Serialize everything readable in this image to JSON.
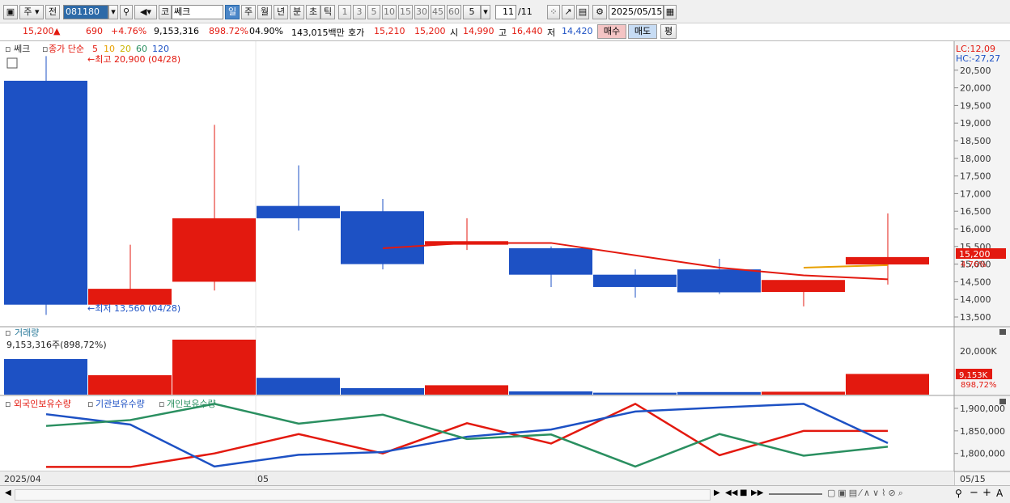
{
  "toolbar": {
    "period_short": "주",
    "prev_label": "전",
    "code": "081180",
    "search_label": "코",
    "stock_name": "쎄크",
    "periods": [
      "일",
      "주",
      "월",
      "년",
      "분",
      "초",
      "틱"
    ],
    "intervals": [
      "1",
      "3",
      "5",
      "10",
      "15",
      "30",
      "45",
      "60"
    ],
    "interval_value": "5",
    "page": "11",
    "page_total": "/11",
    "date": "2025/05/15"
  },
  "quote": {
    "price": "15,200",
    "arrow": "▲",
    "change": "690",
    "change_pct": "+4.76%",
    "volume": "9,153,316",
    "volume_pct": "898.72%",
    "turnover": "04.90%",
    "amount": "143,015백만",
    "hoga_label": "호가",
    "ask": "15,210",
    "bid": "15,200",
    "open_label": "시",
    "open": "14,990",
    "high_label": "고",
    "high": "16,440",
    "low_label": "저",
    "low": "14,420",
    "buy_label": "매수",
    "sell_label": "매도",
    "eval_label": "평"
  },
  "chart": {
    "title": "쎄크",
    "ma_title": "종가 단순",
    "ma_periods": [
      "5",
      "10",
      "20",
      "60",
      "120"
    ],
    "ma_colors": [
      "#e3190f",
      "#e8a000",
      "#c8b400",
      "#2a8f60",
      "#1d51c4"
    ],
    "max_label": "←최고 20,900 (04/28)",
    "min_label": "←최저 13,560 (04/28)",
    "lc": "LC:12,09",
    "hc": "HC:-27,27",
    "price_label": "15,200",
    "pct_label": "4.76%",
    "x_labels": [
      "2025/04",
      "05",
      "05/15"
    ],
    "volume_title": "거래량",
    "volume_value": "9,153,316주(898,72%)",
    "volume_axis": "20,000K",
    "volume_now": "9,153K",
    "volume_pct": "898,72%",
    "holdings_titles": [
      "외국인보유수량",
      "기관보유수량",
      "개인보유수량"
    ]
  },
  "chart_data": [
    {
      "type": "candlestick",
      "title": "쎄크",
      "ylim": [
        13100,
        21300
      ],
      "yticks": [
        13500,
        14000,
        14500,
        15000,
        15500,
        16000,
        16500,
        17000,
        17500,
        18000,
        18500,
        19000,
        19500,
        20000,
        20500
      ],
      "candles": [
        {
          "open": 20200,
          "high": 20900,
          "low": 13560,
          "close": 13850,
          "color": "down"
        },
        {
          "open": 13850,
          "high": 15550,
          "low": 13850,
          "close": 14300,
          "color": "up"
        },
        {
          "open": 14500,
          "high": 18950,
          "low": 14250,
          "close": 16300,
          "color": "up"
        },
        {
          "open": 16650,
          "high": 17800,
          "low": 15950,
          "close": 16300,
          "color": "down"
        },
        {
          "open": 16500,
          "high": 16850,
          "low": 14850,
          "close": 15000,
          "color": "down"
        },
        {
          "open": 15550,
          "high": 16300,
          "low": 15400,
          "close": 15650,
          "color": "up"
        },
        {
          "open": 15450,
          "high": 15500,
          "low": 14350,
          "close": 14700,
          "color": "down"
        },
        {
          "open": 14700,
          "high": 14850,
          "low": 14050,
          "close": 14350,
          "color": "down"
        },
        {
          "open": 14850,
          "high": 15150,
          "low": 14150,
          "close": 14200,
          "color": "down"
        },
        {
          "open": 14210,
          "high": 14500,
          "low": 13800,
          "close": 14550,
          "color": "up"
        },
        {
          "open": 14990,
          "high": 16440,
          "low": 14420,
          "close": 15200,
          "color": "up"
        }
      ],
      "ma5": [
        null,
        null,
        null,
        null,
        15450,
        15600,
        15600,
        15250,
        14900,
        14680,
        14570
      ],
      "ma10": [
        null,
        null,
        null,
        null,
        null,
        null,
        null,
        null,
        null,
        14900,
        14970
      ]
    },
    {
      "type": "bar",
      "title": "거래량",
      "ylim": [
        0,
        22000
      ],
      "values": [
        11000,
        6000,
        17000,
        5200,
        2000,
        2900,
        1000,
        600,
        800,
        900,
        6400
      ],
      "colors": [
        "down",
        "up",
        "up",
        "down",
        "down",
        "up",
        "down",
        "down",
        "down",
        "up",
        "up"
      ]
    },
    {
      "type": "line",
      "ylim": [
        1760000,
        1925000
      ],
      "yticks": [
        1800000,
        1850000,
        1900000
      ],
      "series": [
        {
          "name": "외국인보유수량",
          "color": "#e3190f",
          "values": [
            1770000,
            1770000,
            1800000,
            1843000,
            1800000,
            1867000,
            1822000,
            1910000,
            1796000,
            1850000,
            1850000
          ]
        },
        {
          "name": "기관보유수량",
          "color": "#1d51c4",
          "values": [
            1887000,
            1864000,
            1771000,
            1797000,
            1803000,
            1837000,
            1853000,
            1893000,
            1902000,
            1910000,
            1823000
          ]
        },
        {
          "name": "개인보유수량",
          "color": "#2a8f60",
          "values": [
            1861000,
            1874000,
            1910000,
            1866000,
            1886000,
            1832000,
            1842000,
            1771000,
            1843000,
            1795000,
            1815000
          ]
        }
      ]
    }
  ]
}
